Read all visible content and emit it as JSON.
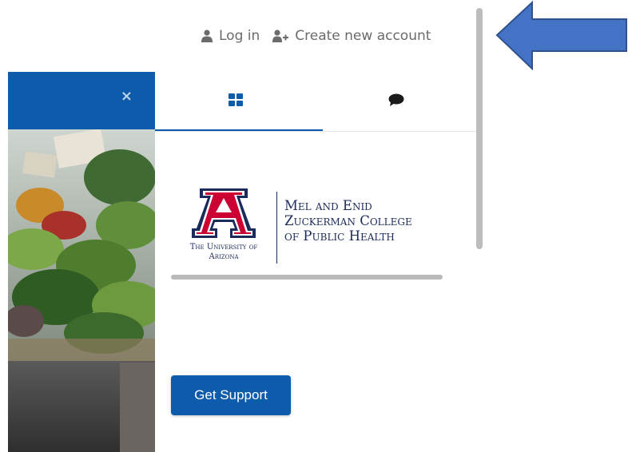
{
  "header": {
    "login_label": "Log in",
    "create_account_label": "Create new account"
  },
  "drawer": {
    "close_symbol": "×",
    "tabs": [
      {
        "icon": "blocks-grid-icon"
      },
      {
        "icon": "chat-bubble-icon"
      }
    ],
    "logo": {
      "university": "The University of Arizona",
      "college_line1": "Mel and Enid",
      "college_line2": "Zuckerman College",
      "college_line3": "of Public Health"
    },
    "support_button_label": "Get Support"
  },
  "colors": {
    "brand_blue": "#0c5cab",
    "arrow_blue": "#4472c4",
    "arizona_red": "#cc0033",
    "arizona_navy": "#1a2a5a",
    "muted_text": "#6b6b6b"
  }
}
